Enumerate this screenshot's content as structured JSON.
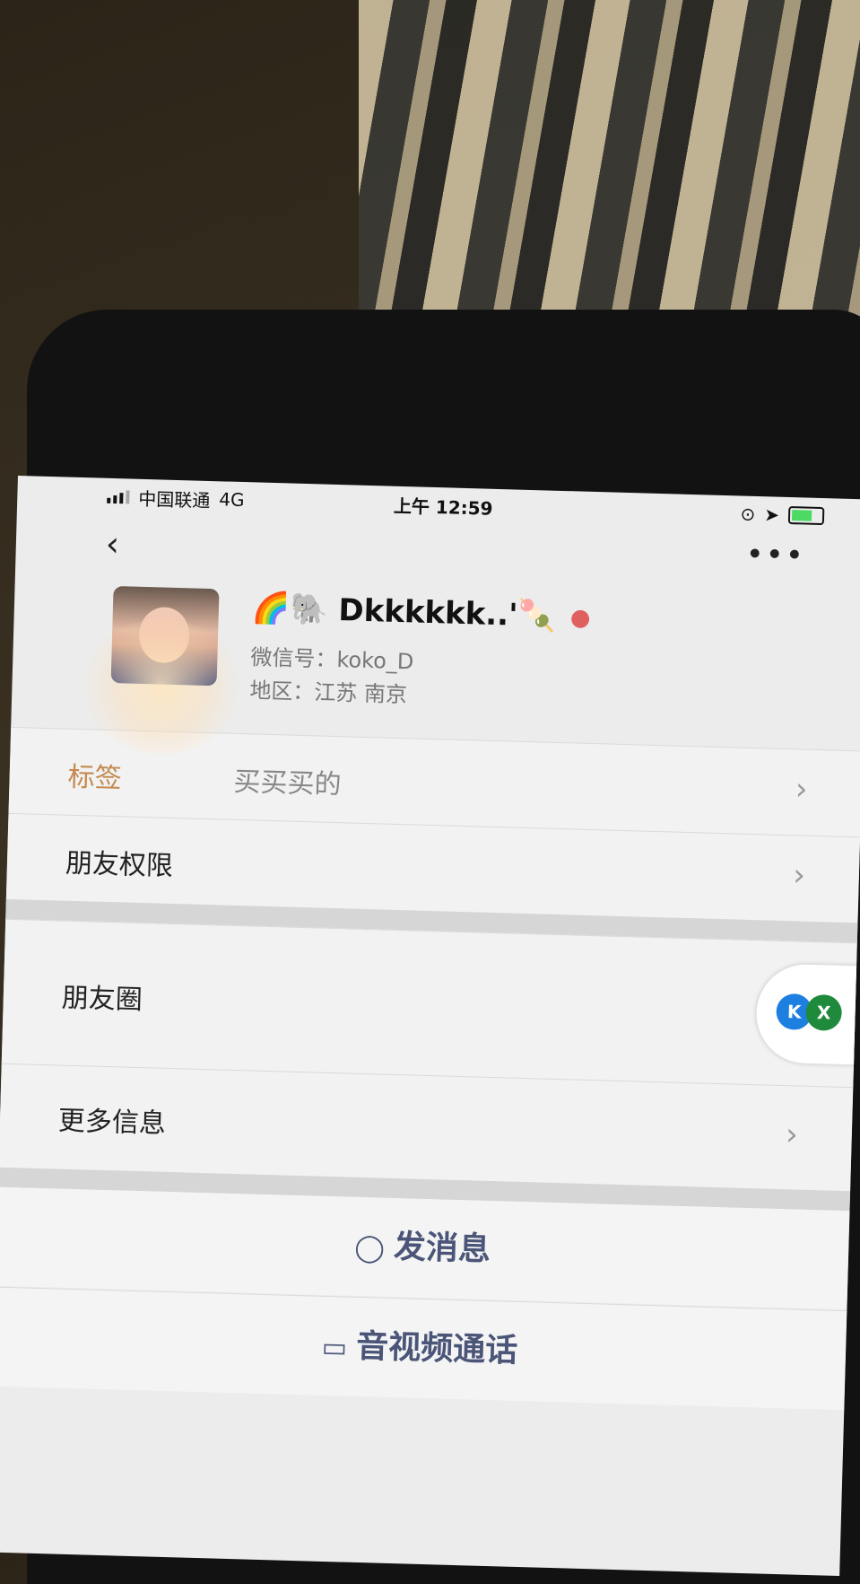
{
  "status_bar": {
    "carrier": "中国联通",
    "network": "4G",
    "time": "上午 12:59",
    "battery_color": "#4cd964"
  },
  "nav": {
    "back_icon": "chevron-left-icon",
    "more_icon": "more-horizontal-icon"
  },
  "profile": {
    "nickname": "🌈🐘 Dkkkkkk..'🍡",
    "wechat_id_text": "微信号：koko_D",
    "region_text": "地区：江苏 南京"
  },
  "rows": {
    "tags_label": "标签",
    "tags_value": "买买买的",
    "permissions_label": "朋友权限",
    "moments_label": "朋友圈",
    "more_info_label": "更多信息"
  },
  "actions": {
    "message_label": "发消息",
    "call_label": "音视频通话"
  },
  "float_badge": {
    "a_text": "K",
    "b_text": "X"
  }
}
